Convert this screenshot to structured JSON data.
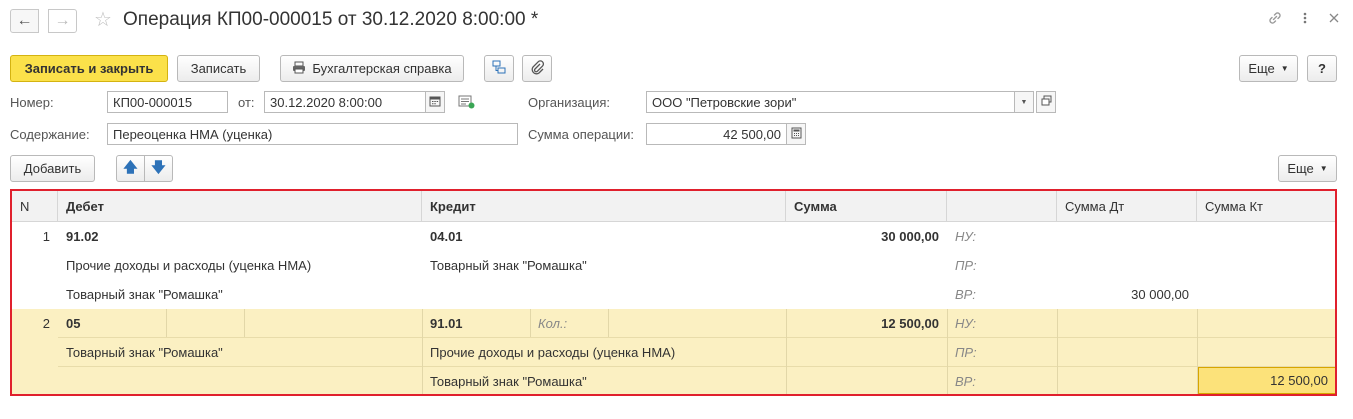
{
  "titlebar": {
    "title": "Операция КП00-000015 от 30.12.2020 8:00:00 *"
  },
  "toolbar": {
    "save_close": "Записать и закрыть",
    "save": "Записать",
    "accounting_note": "Бухгалтерская справка",
    "more": "Еще",
    "help": "?"
  },
  "form": {
    "number_label": "Номер:",
    "number_value": "КП00-000015",
    "from_label": "от:",
    "date_value": "30.12.2020  8:00:00",
    "org_label": "Организация:",
    "org_value": "ООО \"Петровские зори\"",
    "content_label": "Содержание:",
    "content_value": "Переоценка НМА (уценка)",
    "sum_label": "Сумма операции:",
    "sum_value": "42 500,00"
  },
  "table_toolbar": {
    "add": "Добавить",
    "more": "Еще"
  },
  "table": {
    "headers": {
      "n": "N",
      "debit": "Дебет",
      "credit": "Кредит",
      "sum": "Сумма",
      "blank": "",
      "sum_dt": "Сумма Дт",
      "sum_kt": "Сумма Кт"
    },
    "rows": [
      {
        "n": "1",
        "debit": [
          "91.02",
          "Прочие доходы и расходы (уценка НМА)",
          "Товарный знак \"Ромашка\""
        ],
        "credit": [
          "04.01",
          "Товарный знак \"Ромашка\"",
          ""
        ],
        "credit_qty_label": "",
        "sum": "30 000,00",
        "tax_labels": [
          "НУ:",
          "ПР:",
          "ВР:"
        ],
        "sum_dt": [
          "",
          "",
          "30 000,00"
        ],
        "sum_kt": [
          "",
          "",
          ""
        ]
      },
      {
        "n": "2",
        "debit": [
          "05",
          "Товарный знак \"Ромашка\"",
          ""
        ],
        "credit": [
          "91.01",
          "Прочие доходы и расходы (уценка НМА)",
          "Товарный знак \"Ромашка\""
        ],
        "credit_qty_label": "Кол.:",
        "sum": "12 500,00",
        "tax_labels": [
          "НУ:",
          "ПР:",
          "ВР:"
        ],
        "sum_dt": [
          "",
          "",
          ""
        ],
        "sum_kt": [
          "",
          "",
          "12 500,00"
        ]
      }
    ]
  },
  "icons": {
    "back": "arrow-left-icon",
    "forward": "arrow-right-icon",
    "favorite": "star-icon",
    "link": "link-icon",
    "menu": "kebab-menu-icon",
    "close": "close-icon",
    "print": "printer-icon",
    "structure": "document-structure-icon",
    "attach": "paperclip-icon",
    "calendar": "calendar-icon",
    "calculator": "calculator-icon",
    "up": "arrow-up-icon",
    "down": "arrow-down-icon"
  },
  "colors": {
    "primary_button": "#fbe14a",
    "selected_row": "#fbf0c2",
    "highlight_frame": "#e0202d",
    "active_cell": "#fce27a"
  }
}
